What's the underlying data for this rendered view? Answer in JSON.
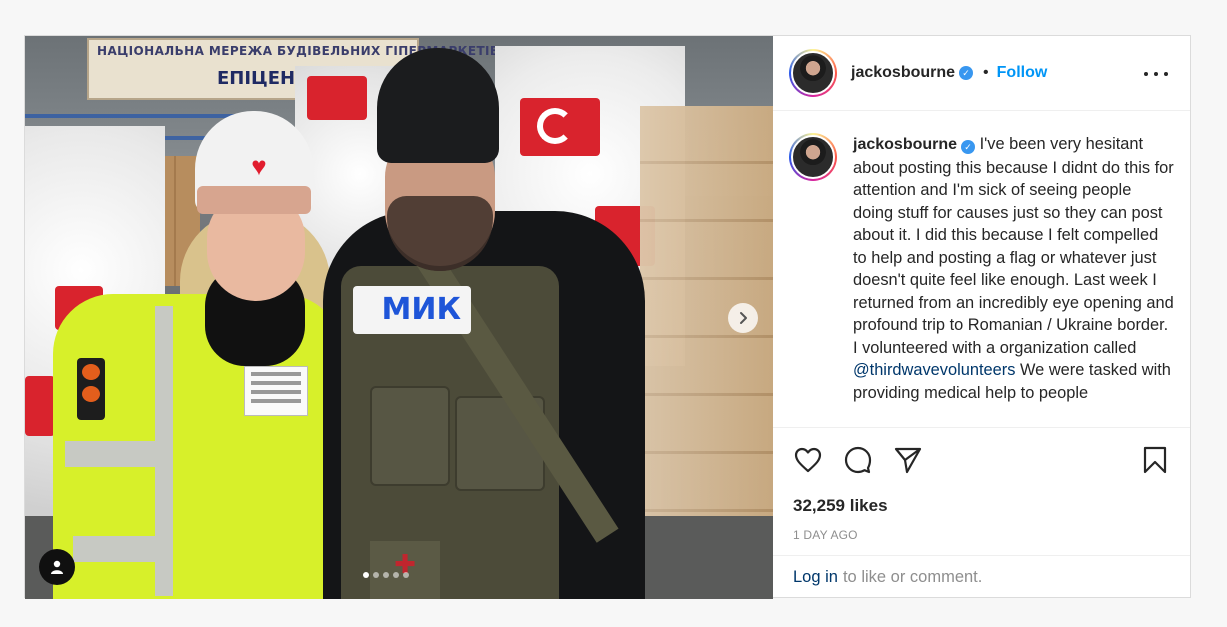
{
  "media": {
    "banner_text": "НАЦІОНАЛЬНА МЕРЕЖА БУДІВЕЛЬНИХ ГІПЕРМАРКЕТІВ",
    "banner_brand": "ЕПІЦЕНТР",
    "press_patch": "МИК",
    "carousel_dots": 5,
    "active_dot": 1
  },
  "header": {
    "username": "jackosbourne",
    "separator": "•",
    "follow_label": "Follow"
  },
  "caption": {
    "username": "jackosbourne",
    "text_before_mention": " I've been very hesitant about posting this because I didnt do this for attention and I'm sick of seeing people doing stuff for causes just so they can post about it. I did this because I felt compelled to help and posting a flag or whatever just doesn't quite feel like enough. Last week I returned from an incredibly eye opening and profound trip to Romanian / Ukraine border. I volunteered with a organization called ",
    "mention": "@thirdwavevolunteers",
    "text_after_mention": " We were tasked with providing medical help to people"
  },
  "stats": {
    "likes": "32,259 likes",
    "date": "1 DAY AGO"
  },
  "footer": {
    "login_label": "Log in",
    "login_suffix": "to like or comment."
  },
  "colors": {
    "follow": "#0095f6",
    "mention": "#00376b",
    "verified": "#3897f0"
  }
}
